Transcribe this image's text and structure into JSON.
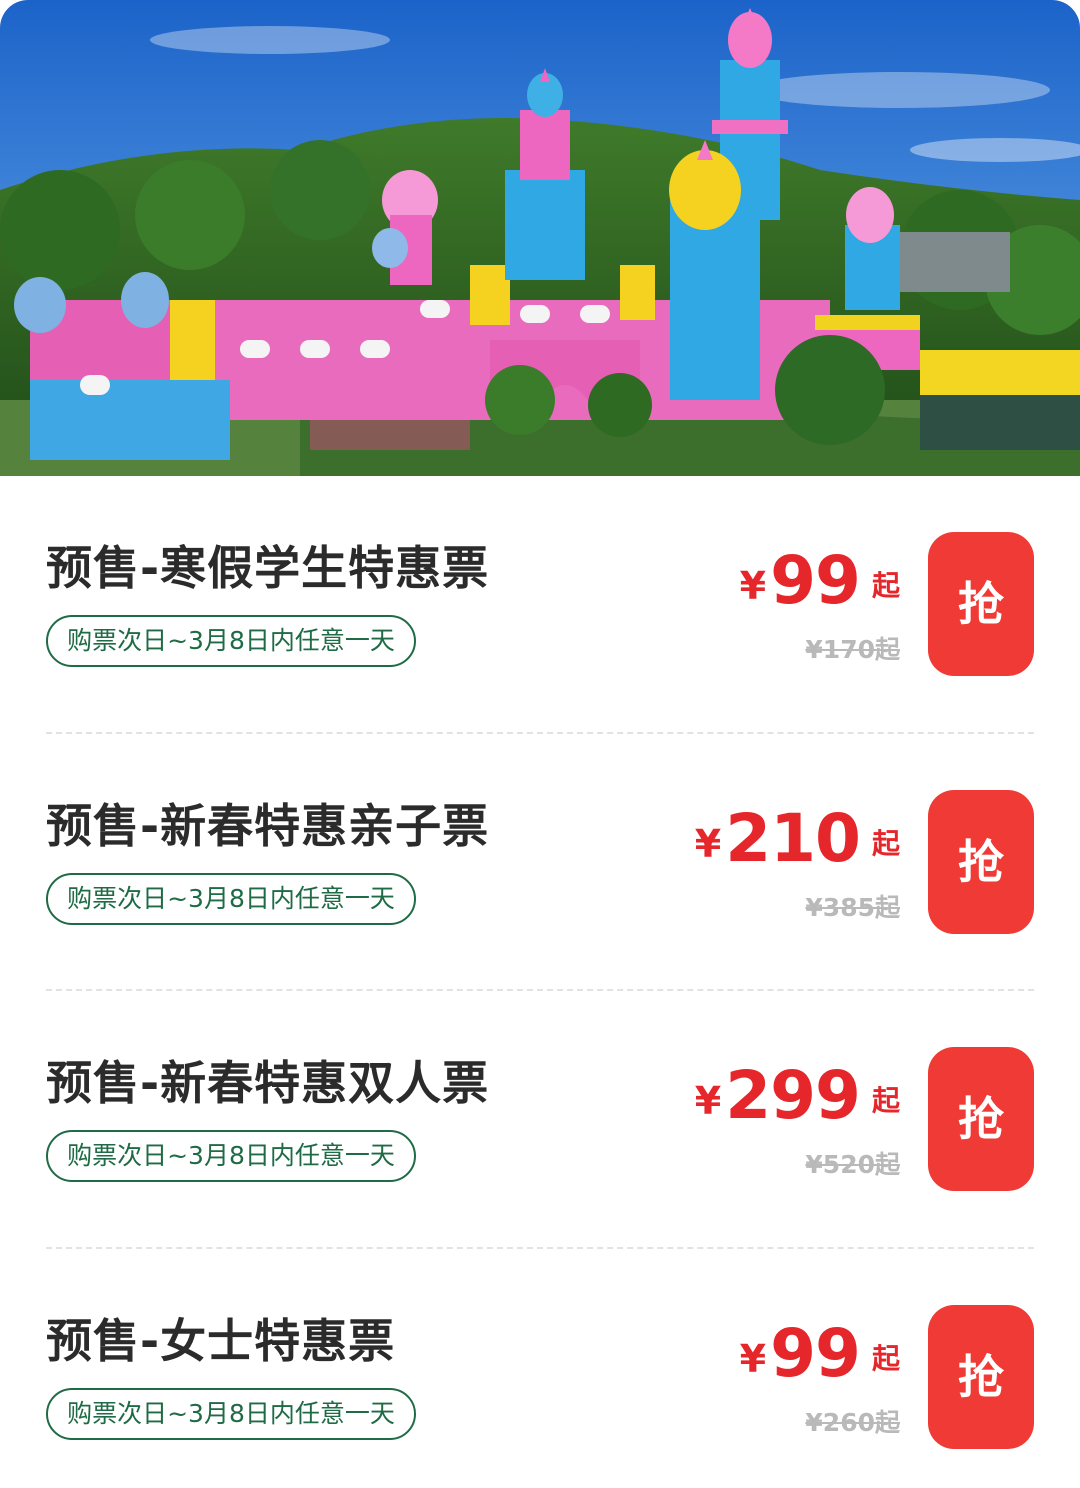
{
  "tickets": [
    {
      "title": "预售-寒假学生特惠票",
      "validity": "购票次日~3月8日内任意一天",
      "currency": "¥",
      "price": "99",
      "suffix": "起",
      "original_price": "¥170起",
      "button_label": "抢"
    },
    {
      "title": "预售-新春特惠亲子票",
      "validity": "购票次日~3月8日内任意一天",
      "currency": "¥",
      "price": "210",
      "suffix": "起",
      "original_price": "¥385起",
      "button_label": "抢"
    },
    {
      "title": "预售-新春特惠双人票",
      "validity": "购票次日~3月8日内任意一天",
      "currency": "¥",
      "price": "299",
      "suffix": "起",
      "original_price": "¥520起",
      "button_label": "抢"
    },
    {
      "title": "预售-女士特惠票",
      "validity": "购票次日~3月8日内任意一天",
      "currency": "¥",
      "price": "99",
      "suffix": "起",
      "original_price": "¥260起",
      "button_label": "抢"
    }
  ],
  "colors": {
    "accent": "#e5262a",
    "button": "#f03a35",
    "pill": "#1f6b45",
    "muted": "#b9b9b9"
  }
}
